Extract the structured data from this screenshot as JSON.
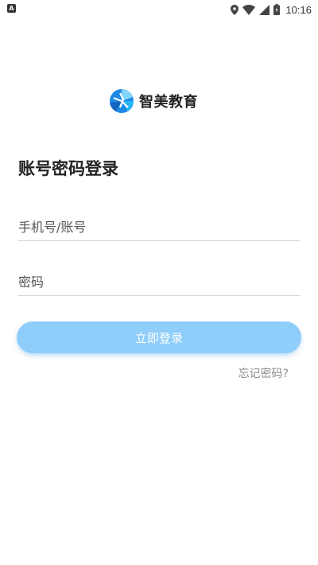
{
  "status_bar": {
    "notification_icon": "app-notification-icon",
    "time": "10:16"
  },
  "logo": {
    "text": "智美教育",
    "colors": [
      "#1e88e5",
      "#29b6f6",
      "#81d4fa"
    ]
  },
  "login": {
    "title": "账号密码登录",
    "account_placeholder": "手机号/账号",
    "password_placeholder": "密码",
    "submit_label": "立即登录",
    "forgot_label": "忘记密码?"
  },
  "colors": {
    "button_bg": "#8fcdfa",
    "divider": "#d4d4d4",
    "link": "#8a8a8a"
  }
}
